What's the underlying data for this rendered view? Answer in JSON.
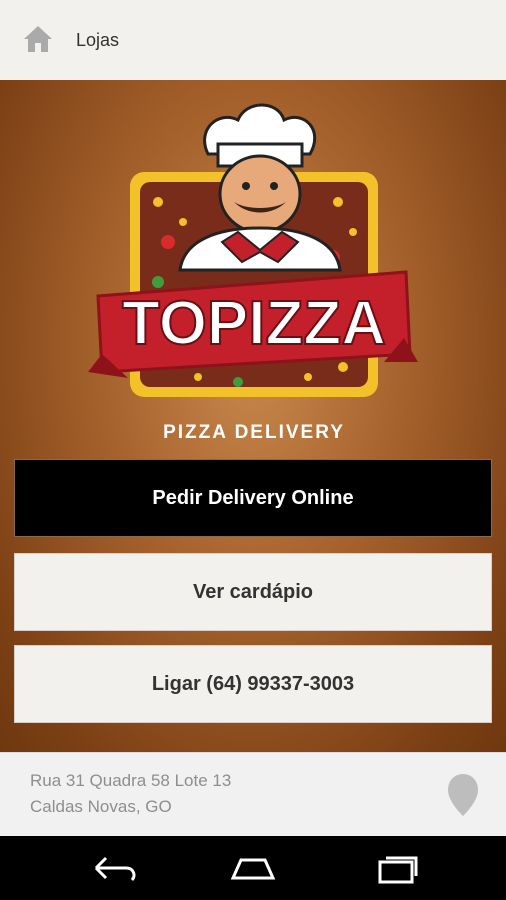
{
  "topbar": {
    "title": "Lojas"
  },
  "logo": {
    "brand": "TOPIZZA",
    "tagline": "PIZZA DELIVERY"
  },
  "actions": {
    "delivery_label": "Pedir Delivery Online",
    "menu_label": "Ver cardápio",
    "call_label": "Ligar (64) 99337-3003"
  },
  "address": {
    "line1": "Rua 31 Quadra 58 Lote 13",
    "line2": "Caldas Novas, GO"
  },
  "icons": {
    "home": "home-icon",
    "map_pin": "map-pin-icon",
    "back": "back-icon",
    "nav_home": "home-nav-icon",
    "recents": "recents-icon"
  },
  "colors": {
    "topbar_bg": "#f3f1ee",
    "hero_brown": "#a8642e",
    "brand_red": "#c4202b",
    "button_dark": "#000000",
    "button_light": "#f3f1ee"
  }
}
